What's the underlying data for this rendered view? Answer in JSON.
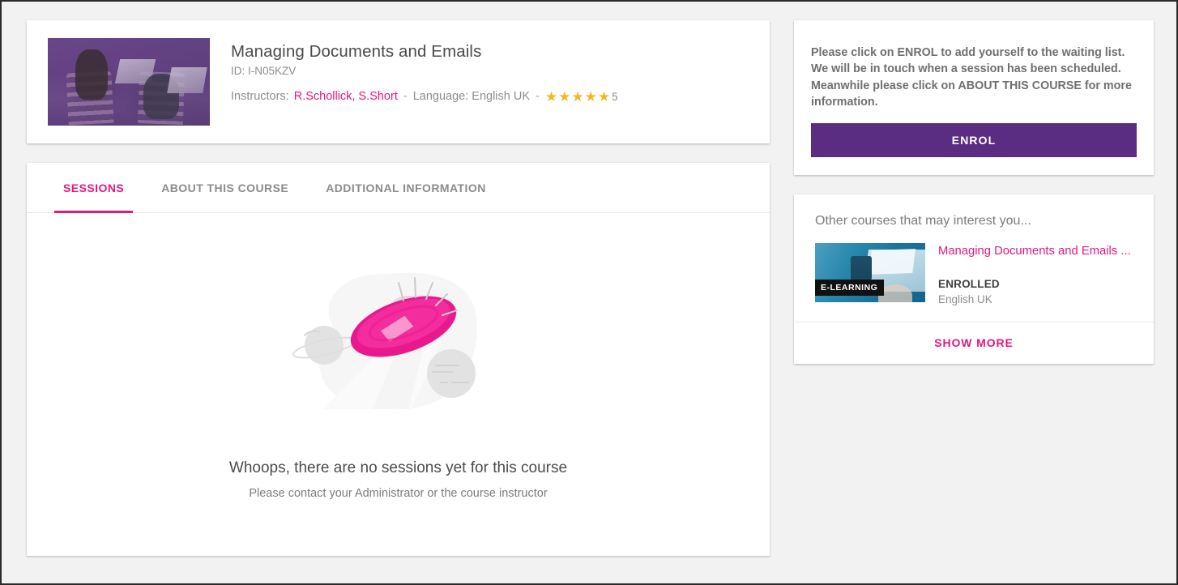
{
  "course": {
    "title": "Managing Documents and Emails",
    "id_label": "ID: I-N05KZV",
    "instructors_label": "Instructors:",
    "instructors": "R.Schollick, S.Short",
    "separator": "-",
    "language": "Language: English UK",
    "rating_value": "5",
    "rating_stars": 5,
    "thumbnail_alt": "course-thumbnail"
  },
  "tabs": [
    {
      "label": "SESSIONS",
      "active": true
    },
    {
      "label": "ABOUT THIS COURSE",
      "active": false
    },
    {
      "label": "ADDITIONAL INFORMATION",
      "active": false
    }
  ],
  "empty_state": {
    "illustration": "ufo-illustration",
    "title": "Whoops, there are no sessions yet for this course",
    "subtitle": "Please contact your Administrator or the course instructor"
  },
  "enrol_panel": {
    "message": "Please click on ENROL to add yourself to the waiting list. We will be in touch when a session has been scheduled. Meanwhile please click on ABOUT THIS COURSE for more information.",
    "button_label": "ENROL"
  },
  "other_courses": {
    "heading": "Other courses that may interest you...",
    "items": [
      {
        "title": "Managing Documents and Emails ...",
        "badge": "E-LEARNING",
        "status": "ENROLLED",
        "language": "English UK"
      }
    ],
    "show_more_label": "SHOW MORE"
  },
  "colors": {
    "accent_pink": "#e4177e",
    "enrol_purple": "#5a2d82",
    "star_gold": "#f2b824",
    "page_background": "#f2f2f2",
    "card_background": "#ffffff",
    "text_primary": "#4b4b4b",
    "text_muted": "#8d8d8d",
    "badge_background": "#111111"
  }
}
